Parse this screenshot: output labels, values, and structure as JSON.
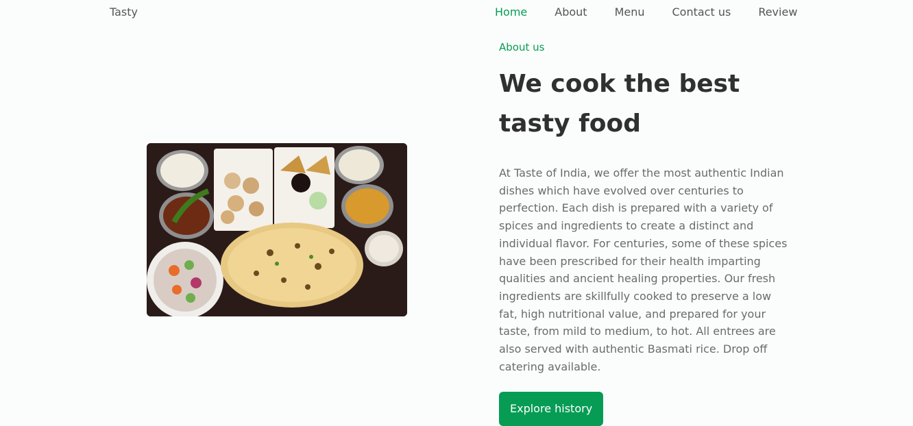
{
  "nav": {
    "logo": "Tasty",
    "links": [
      "Home",
      "About",
      "Menu",
      "Contact us",
      "Review"
    ],
    "active": "Home"
  },
  "about": {
    "subtitle": "About us",
    "title": "We cook the best tasty food",
    "description": "At Taste of India, we offer the most authentic Indian dishes which have evolved over centuries to perfection. Each dish is prepared with a variety of spices and ingredients to create a distinct and individual flavor. For centuries, some of these spices have been prescribed for their health imparting qualities and ancient healing properties. Our fresh ingredients are skillfully cooked to preserve a low fat, high nutritional value, and prepared for your taste, from mild to medium, to hot. All entrees are also served with authentic Basmati rice. Drop off catering available.",
    "button_label": "Explore history"
  },
  "colors": {
    "accent": "#069c54",
    "text": "#303030",
    "muted": "#6a6a6a",
    "background": "#fbfdfc"
  }
}
